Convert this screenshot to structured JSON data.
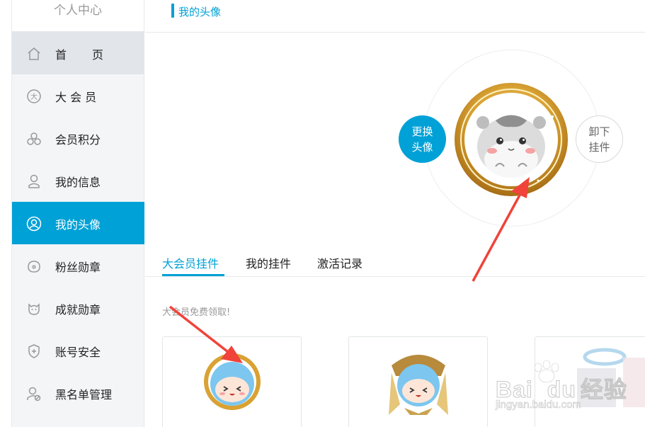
{
  "sidebar": {
    "title": "个人中心",
    "items": [
      {
        "label": "首",
        "label2": "页",
        "icon": "home-icon"
      },
      {
        "label": "大 会 员",
        "icon": "vip-badge-icon"
      },
      {
        "label": "会员积分",
        "icon": "points-icon"
      },
      {
        "label": "我的信息",
        "icon": "user-icon"
      },
      {
        "label": "我的头像",
        "icon": "avatar-icon"
      },
      {
        "label": "粉丝勋章",
        "icon": "fan-medal-icon"
      },
      {
        "label": "成就勋章",
        "icon": "achievement-icon"
      },
      {
        "label": "账号安全",
        "icon": "shield-icon"
      },
      {
        "label": "黑名单管理",
        "icon": "blacklist-icon"
      }
    ]
  },
  "header": {
    "title": "我的头像"
  },
  "avatar": {
    "change_label_1": "更换",
    "change_label_2": "头像",
    "remove_label_1": "卸下",
    "remove_label_2": "挂件"
  },
  "tabs": [
    "大会员挂件",
    "我的挂件",
    "激活记录"
  ],
  "hint": "大会员免费领取!",
  "watermark": {
    "brand": "Bai",
    "brand2": "du",
    "cn": "经验",
    "url": "jingyan.baidu.com"
  },
  "colors": {
    "accent": "#00a1d6",
    "arrow": "#f0433a",
    "gold": "#d9a233"
  }
}
